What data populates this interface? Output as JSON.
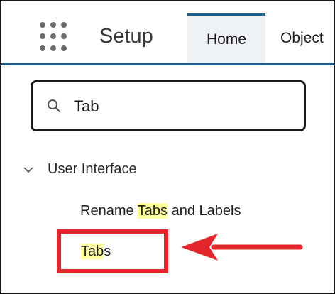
{
  "header": {
    "title": "Setup",
    "tabs": [
      {
        "label": "Home",
        "active": true
      },
      {
        "label": "Object",
        "active": false
      }
    ]
  },
  "search": {
    "value": "Tab",
    "icon": "search-icon"
  },
  "tree": {
    "group_label": "User Interface",
    "group_expanded": true,
    "items": [
      {
        "label_parts": [
          "Rename ",
          "Tabs",
          " and Labels"
        ],
        "highlight": "Tabs"
      },
      {
        "label_parts": [
          "Tab",
          "s"
        ],
        "highlight": "Tab"
      }
    ]
  },
  "annotation": {
    "color": "#e3262c",
    "highlight_color": "#ffff9e",
    "accent_color": "#1b5e8e"
  }
}
